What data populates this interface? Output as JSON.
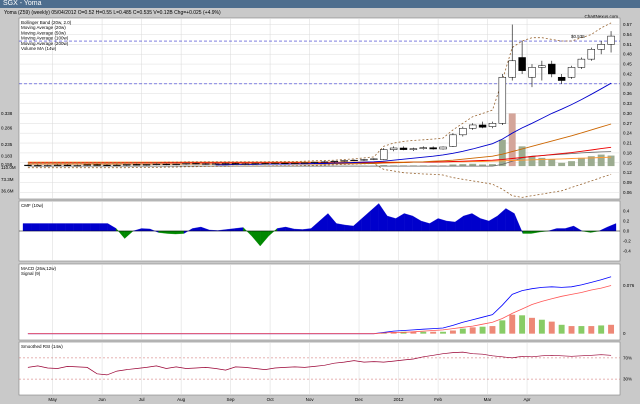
{
  "window": {
    "title": "SGX - Yoma"
  },
  "header": {
    "line": "Yoma (Z59) (weekly)     05/04/2012     O=0.52     H=0.55     L=0.485     C=0.535     V=0.12B     Chg=+0.025 (+4.9%)"
  },
  "watermark": "ChartNexus.com",
  "price_legend": [
    "Bollinger Band (20w, 2.0)",
    "Moving Average (20w)",
    "Moving Average (50w)",
    "Moving Average (100w)",
    "Moving Average (200w)",
    "Volume MA (14w)"
  ],
  "colors": {
    "bg": "#c9c9c9",
    "panel": "#ffffff",
    "bollinger": "#996633",
    "ma20": "#0000cc",
    "ma50": "#cc6600",
    "ma100": "#ee0000",
    "ma200": "#ff9933",
    "volume": "#9cac90",
    "cmf": "#0000cc",
    "cmf_neg": "#008800",
    "macd": "#0000ff",
    "signal": "#ff5555",
    "rsi": "#990033"
  },
  "chart_data": [
    {
      "type": "candlestick",
      "title": "Yoma (Z59) (weekly)",
      "right_ticks": [
        0.57,
        0.54,
        0.51,
        0.48,
        0.45,
        0.42,
        0.39,
        0.36,
        0.33,
        0.3,
        0.27,
        0.24,
        0.21,
        0.18,
        0.15,
        0.12,
        0.09,
        0.06
      ],
      "left_ticks": [
        {
          "label": "0.338",
          "v": 0.3
        },
        {
          "label": "0.286",
          "v": 0.255
        },
        {
          "label": "0.235",
          "v": 0.205
        },
        {
          "label": "0.183",
          "v": 0.17
        },
        {
          "label": "0.158",
          "v": 0.145
        },
        {
          "label": "110.0M",
          "v": 0.135
        },
        {
          "label": "73.3M",
          "v": 0.1
        },
        {
          "label": "36.6M",
          "v": 0.065
        }
      ],
      "ylim": [
        0.04,
        0.59
      ],
      "annotation": "$0.535",
      "hlines": [
        0.52,
        0.39
      ],
      "x_labels": [
        "May",
        "Jun",
        "Jul",
        "Aug",
        "Sep",
        "Oct",
        "Nov",
        "Dec",
        "2012",
        "Feb",
        "Mar",
        "Apr"
      ],
      "candles": [
        {
          "o": 0.143,
          "h": 0.145,
          "l": 0.14,
          "c": 0.142
        },
        {
          "o": 0.142,
          "h": 0.145,
          "l": 0.14,
          "c": 0.141
        },
        {
          "o": 0.141,
          "h": 0.144,
          "l": 0.139,
          "c": 0.142
        },
        {
          "o": 0.142,
          "h": 0.145,
          "l": 0.14,
          "c": 0.143
        },
        {
          "o": 0.143,
          "h": 0.145,
          "l": 0.14,
          "c": 0.141
        },
        {
          "o": 0.141,
          "h": 0.144,
          "l": 0.139,
          "c": 0.142
        },
        {
          "o": 0.142,
          "h": 0.145,
          "l": 0.141,
          "c": 0.144
        },
        {
          "o": 0.144,
          "h": 0.146,
          "l": 0.141,
          "c": 0.143
        },
        {
          "o": 0.143,
          "h": 0.145,
          "l": 0.14,
          "c": 0.142
        },
        {
          "o": 0.142,
          "h": 0.145,
          "l": 0.14,
          "c": 0.143
        },
        {
          "o": 0.143,
          "h": 0.146,
          "l": 0.141,
          "c": 0.145
        },
        {
          "o": 0.145,
          "h": 0.147,
          "l": 0.143,
          "c": 0.144
        },
        {
          "o": 0.144,
          "h": 0.146,
          "l": 0.142,
          "c": 0.145
        },
        {
          "o": 0.145,
          "h": 0.148,
          "l": 0.143,
          "c": 0.146
        },
        {
          "o": 0.146,
          "h": 0.148,
          "l": 0.143,
          "c": 0.145
        },
        {
          "o": 0.145,
          "h": 0.147,
          "l": 0.143,
          "c": 0.146
        },
        {
          "o": 0.146,
          "h": 0.15,
          "l": 0.144,
          "c": 0.148
        },
        {
          "o": 0.148,
          "h": 0.15,
          "l": 0.145,
          "c": 0.147
        },
        {
          "o": 0.147,
          "h": 0.149,
          "l": 0.144,
          "c": 0.146
        },
        {
          "o": 0.146,
          "h": 0.149,
          "l": 0.144,
          "c": 0.147
        },
        {
          "o": 0.147,
          "h": 0.15,
          "l": 0.145,
          "c": 0.148
        },
        {
          "o": 0.148,
          "h": 0.15,
          "l": 0.145,
          "c": 0.146
        },
        {
          "o": 0.146,
          "h": 0.149,
          "l": 0.144,
          "c": 0.147
        },
        {
          "o": 0.147,
          "h": 0.149,
          "l": 0.145,
          "c": 0.148
        },
        {
          "o": 0.148,
          "h": 0.15,
          "l": 0.145,
          "c": 0.147
        },
        {
          "o": 0.147,
          "h": 0.15,
          "l": 0.145,
          "c": 0.149
        },
        {
          "o": 0.149,
          "h": 0.151,
          "l": 0.146,
          "c": 0.148
        },
        {
          "o": 0.148,
          "h": 0.15,
          "l": 0.146,
          "c": 0.149
        },
        {
          "o": 0.149,
          "h": 0.151,
          "l": 0.147,
          "c": 0.15
        },
        {
          "o": 0.15,
          "h": 0.153,
          "l": 0.148,
          "c": 0.152
        },
        {
          "o": 0.152,
          "h": 0.155,
          "l": 0.15,
          "c": 0.153
        },
        {
          "o": 0.153,
          "h": 0.156,
          "l": 0.151,
          "c": 0.155
        },
        {
          "o": 0.155,
          "h": 0.158,
          "l": 0.153,
          "c": 0.157
        },
        {
          "o": 0.157,
          "h": 0.16,
          "l": 0.155,
          "c": 0.158
        },
        {
          "o": 0.158,
          "h": 0.162,
          "l": 0.156,
          "c": 0.16
        },
        {
          "o": 0.16,
          "h": 0.164,
          "l": 0.158,
          "c": 0.162
        },
        {
          "o": 0.16,
          "h": 0.195,
          "l": 0.158,
          "c": 0.19
        },
        {
          "o": 0.19,
          "h": 0.2,
          "l": 0.185,
          "c": 0.195
        },
        {
          "o": 0.195,
          "h": 0.2,
          "l": 0.188,
          "c": 0.19
        },
        {
          "o": 0.19,
          "h": 0.196,
          "l": 0.186,
          "c": 0.193
        },
        {
          "o": 0.193,
          "h": 0.2,
          "l": 0.19,
          "c": 0.196
        },
        {
          "o": 0.196,
          "h": 0.2,
          "l": 0.19,
          "c": 0.192
        },
        {
          "o": 0.192,
          "h": 0.2,
          "l": 0.19,
          "c": 0.198
        },
        {
          "o": 0.2,
          "h": 0.24,
          "l": 0.198,
          "c": 0.235
        },
        {
          "o": 0.235,
          "h": 0.26,
          "l": 0.23,
          "c": 0.255
        },
        {
          "o": 0.255,
          "h": 0.27,
          "l": 0.25,
          "c": 0.265
        },
        {
          "o": 0.265,
          "h": 0.275,
          "l": 0.255,
          "c": 0.258
        },
        {
          "o": 0.26,
          "h": 0.275,
          "l": 0.255,
          "c": 0.27
        },
        {
          "o": 0.27,
          "h": 0.42,
          "l": 0.265,
          "c": 0.41
        },
        {
          "o": 0.41,
          "h": 0.57,
          "l": 0.4,
          "c": 0.46
        },
        {
          "o": 0.47,
          "h": 0.52,
          "l": 0.42,
          "c": 0.43
        },
        {
          "o": 0.41,
          "h": 0.45,
          "l": 0.38,
          "c": 0.44
        },
        {
          "o": 0.44,
          "h": 0.46,
          "l": 0.4,
          "c": 0.445
        },
        {
          "o": 0.45,
          "h": 0.46,
          "l": 0.41,
          "c": 0.42
        },
        {
          "o": 0.41,
          "h": 0.42,
          "l": 0.39,
          "c": 0.4
        },
        {
          "o": 0.41,
          "h": 0.445,
          "l": 0.405,
          "c": 0.44
        },
        {
          "o": 0.44,
          "h": 0.47,
          "l": 0.435,
          "c": 0.465
        },
        {
          "o": 0.465,
          "h": 0.5,
          "l": 0.46,
          "c": 0.495
        },
        {
          "o": 0.495,
          "h": 0.52,
          "l": 0.48,
          "c": 0.51
        },
        {
          "o": 0.51,
          "h": 0.55,
          "l": 0.485,
          "c": 0.535
        }
      ],
      "bollinger_upper": [
        0.15,
        0.15,
        0.15,
        0.15,
        0.15,
        0.15,
        0.15,
        0.15,
        0.15,
        0.15,
        0.15,
        0.151,
        0.151,
        0.151,
        0.152,
        0.152,
        0.153,
        0.153,
        0.153,
        0.153,
        0.153,
        0.153,
        0.153,
        0.153,
        0.153,
        0.154,
        0.154,
        0.154,
        0.155,
        0.156,
        0.157,
        0.158,
        0.16,
        0.162,
        0.165,
        0.168,
        0.2,
        0.21,
        0.215,
        0.218,
        0.22,
        0.222,
        0.225,
        0.25,
        0.27,
        0.29,
        0.3,
        0.31,
        0.4,
        0.5,
        0.52,
        0.53,
        0.53,
        0.525,
        0.52,
        0.52,
        0.53,
        0.54,
        0.56,
        0.575
      ],
      "bollinger_lower": [
        0.135,
        0.135,
        0.135,
        0.135,
        0.135,
        0.135,
        0.135,
        0.135,
        0.135,
        0.135,
        0.135,
        0.136,
        0.136,
        0.136,
        0.137,
        0.137,
        0.138,
        0.138,
        0.139,
        0.139,
        0.139,
        0.14,
        0.14,
        0.14,
        0.14,
        0.141,
        0.141,
        0.141,
        0.142,
        0.142,
        0.143,
        0.144,
        0.145,
        0.146,
        0.147,
        0.148,
        0.13,
        0.125,
        0.12,
        0.118,
        0.116,
        0.115,
        0.113,
        0.105,
        0.1,
        0.095,
        0.09,
        0.085,
        0.07,
        0.05,
        0.045,
        0.05,
        0.055,
        0.06,
        0.065,
        0.075,
        0.085,
        0.095,
        0.105,
        0.115
      ],
      "ma20": [
        null,
        null,
        null,
        null,
        null,
        null,
        null,
        null,
        null,
        null,
        null,
        null,
        null,
        null,
        null,
        null,
        null,
        null,
        null,
        0.144,
        0.144,
        0.145,
        0.145,
        0.145,
        0.146,
        0.146,
        0.146,
        0.147,
        0.147,
        0.148,
        0.148,
        0.149,
        0.15,
        0.151,
        0.152,
        0.153,
        0.155,
        0.158,
        0.161,
        0.164,
        0.167,
        0.17,
        0.174,
        0.179,
        0.185,
        0.192,
        0.2,
        0.208,
        0.222,
        0.24,
        0.256,
        0.27,
        0.285,
        0.3,
        0.313,
        0.327,
        0.342,
        0.358,
        0.375,
        0.392
      ],
      "ma50": [
        0.146,
        0.146,
        0.146,
        0.146,
        0.146,
        0.146,
        0.146,
        0.146,
        0.146,
        0.146,
        0.146,
        0.146,
        0.146,
        0.146,
        0.146,
        0.146,
        0.146,
        0.146,
        0.146,
        0.146,
        0.146,
        0.146,
        0.146,
        0.146,
        0.146,
        0.146,
        0.146,
        0.146,
        0.146,
        0.146,
        0.146,
        0.147,
        0.147,
        0.147,
        0.148,
        0.148,
        0.149,
        0.15,
        0.151,
        0.152,
        0.153,
        0.155,
        0.156,
        0.158,
        0.161,
        0.164,
        0.167,
        0.17,
        0.176,
        0.184,
        0.192,
        0.2,
        0.208,
        0.216,
        0.224,
        0.232,
        0.241,
        0.25,
        0.259,
        0.268
      ],
      "ma100": [
        0.15,
        0.15,
        0.15,
        0.15,
        0.15,
        0.15,
        0.15,
        0.15,
        0.15,
        0.15,
        0.15,
        0.15,
        0.15,
        0.15,
        0.15,
        0.15,
        0.15,
        0.15,
        0.15,
        0.15,
        0.15,
        0.15,
        0.15,
        0.15,
        0.15,
        0.15,
        0.15,
        0.15,
        0.15,
        0.15,
        0.15,
        0.15,
        0.15,
        0.15,
        0.15,
        0.15,
        0.151,
        0.151,
        0.151,
        0.152,
        0.152,
        0.152,
        0.153,
        0.154,
        0.155,
        0.156,
        0.157,
        0.158,
        0.16,
        0.163,
        0.166,
        0.169,
        0.172,
        0.175,
        0.178,
        0.181,
        0.185,
        0.189,
        0.193,
        0.197
      ],
      "ma200": [
        0.152,
        0.152,
        0.152,
        0.152,
        0.152,
        0.152,
        0.152,
        0.152,
        0.152,
        0.152,
        0.152,
        0.152,
        0.152,
        0.152,
        0.152,
        0.152,
        0.152,
        0.152,
        0.152,
        0.152,
        0.152,
        0.152,
        0.152,
        0.152,
        0.152,
        0.152,
        0.152,
        0.152,
        0.152,
        0.152,
        0.152,
        0.152,
        0.152,
        0.152,
        0.152,
        0.152,
        0.152,
        0.152,
        0.152,
        0.152,
        0.152,
        0.152,
        0.152,
        0.153,
        0.153,
        0.154,
        0.154,
        0.155,
        0.156,
        0.157,
        0.158,
        0.159,
        0.16,
        0.161,
        0.162,
        0.163,
        0.164,
        0.165,
        0.166,
        0.167
      ],
      "volume": [
        0.141,
        0.141,
        0.141,
        0.141,
        0.141,
        0.141,
        0.141,
        0.141,
        0.141,
        0.141,
        0.141,
        0.141,
        0.141,
        0.141,
        0.141,
        0.141,
        0.141,
        0.141,
        0.141,
        0.141,
        0.141,
        0.141,
        0.141,
        0.141,
        0.141,
        0.141,
        0.141,
        0.141,
        0.141,
        0.141,
        0.141,
        0.141,
        0.141,
        0.141,
        0.141,
        0.141,
        0.143,
        0.142,
        0.142,
        0.142,
        0.142,
        0.142,
        0.142,
        0.145,
        0.146,
        0.147,
        0.145,
        0.146,
        0.22,
        0.3,
        0.2,
        0.17,
        0.165,
        0.16,
        0.15,
        0.155,
        0.165,
        0.17,
        0.175,
        0.172
      ],
      "volume_ma": [
        0.14,
        0.14,
        0.14,
        0.14,
        0.14,
        0.14,
        0.14,
        0.14,
        0.14,
        0.14,
        0.14,
        0.14,
        0.14,
        0.14,
        0.14,
        0.14,
        0.14,
        0.14,
        0.14,
        0.14,
        0.14,
        0.14,
        0.14,
        0.14,
        0.14,
        0.14,
        0.14,
        0.14,
        0.14,
        0.14,
        0.14,
        0.14,
        0.14,
        0.14,
        0.14,
        0.14,
        0.14,
        0.14,
        0.14,
        0.14,
        0.14,
        0.14,
        0.14,
        0.14,
        0.14,
        0.14,
        0.14,
        0.14,
        0.145,
        0.155,
        0.165,
        0.17,
        0.172,
        0.174,
        0.176,
        0.178,
        0.18,
        0.182,
        0.183,
        0.184
      ]
    },
    {
      "type": "area",
      "title": "CMF (10w)",
      "ylim": [
        -0.6,
        0.6
      ],
      "ticks": [
        0.4,
        0.2,
        0.0,
        -0.2,
        -0.4
      ],
      "values": [
        0.15,
        0.15,
        0.15,
        0.15,
        0.15,
        0.15,
        0.15,
        0.15,
        0.15,
        0.15,
        0.15,
        0.05,
        -0.15,
        0.0,
        0.05,
        0.04,
        -0.03,
        -0.05,
        -0.06,
        -0.05,
        0.05,
        0.08,
        0.02,
        0.01,
        0.03,
        0.05,
        0.07,
        -0.1,
        -0.3,
        -0.1,
        0.05,
        0.08,
        0.04,
        0.03,
        0.05,
        0.2,
        0.35,
        0.15,
        0.12,
        0.1,
        0.25,
        0.4,
        0.55,
        0.3,
        0.25,
        0.35,
        0.3,
        0.2,
        0.15,
        0.25,
        0.2,
        0.18,
        0.3,
        0.35,
        0.25,
        0.2,
        0.3,
        0.45,
        0.35,
        -0.05,
        -0.05,
        -0.02,
        0.0,
        0.05,
        0.05,
        0.1,
        0.0,
        -0.03,
        0.0,
        0.08,
        0.15
      ]
    },
    {
      "type": "line",
      "title": "MACD (26w,12w)",
      "legend": [
        "Signal (9)"
      ],
      "ylim": [
        -0.01,
        0.11
      ],
      "ticks": [
        {
          "label": "0.076",
          "v": 0.076
        },
        {
          "label": "0",
          "v": 0.0
        }
      ],
      "macd": [
        0,
        0,
        0,
        0,
        0,
        0,
        0,
        0,
        0,
        0,
        0,
        0,
        0,
        0,
        0,
        0,
        0,
        0,
        0,
        0,
        0,
        0,
        0,
        0,
        0,
        0,
        0,
        0,
        0,
        0,
        0,
        0,
        0,
        0,
        0,
        0,
        0.002,
        0.004,
        0.005,
        0.006,
        0.007,
        0.008,
        0.009,
        0.013,
        0.018,
        0.022,
        0.026,
        0.03,
        0.045,
        0.062,
        0.068,
        0.071,
        0.073,
        0.074,
        0.073,
        0.074,
        0.077,
        0.081,
        0.085,
        0.09
      ],
      "signal": [
        0,
        0,
        0,
        0,
        0,
        0,
        0,
        0,
        0,
        0,
        0,
        0,
        0,
        0,
        0,
        0,
        0,
        0,
        0,
        0,
        0,
        0,
        0,
        0,
        0,
        0,
        0,
        0,
        0,
        0,
        0,
        0,
        0,
        0,
        0,
        0,
        0.001,
        0.002,
        0.002,
        0.003,
        0.004,
        0.005,
        0.006,
        0.008,
        0.01,
        0.012,
        0.015,
        0.018,
        0.024,
        0.032,
        0.039,
        0.046,
        0.051,
        0.055,
        0.059,
        0.062,
        0.065,
        0.069,
        0.072,
        0.076
      ]
    },
    {
      "type": "line",
      "title": "Smoothed RSI (14w)",
      "ylim": [
        0,
        100
      ],
      "ticks": [
        {
          "label": "70%",
          "v": 70
        },
        {
          "label": "30%",
          "v": 30
        }
      ],
      "values": [
        52,
        55,
        51,
        50,
        54,
        53,
        52,
        40,
        38,
        45,
        48,
        50,
        52,
        55,
        50,
        53,
        50,
        51,
        52,
        50,
        47,
        53,
        52,
        50,
        48,
        51,
        52,
        53,
        52,
        54,
        56,
        60,
        62,
        65,
        62,
        63,
        62,
        64,
        66,
        68,
        72,
        75,
        78,
        80,
        81,
        78,
        77,
        74,
        72,
        70,
        73,
        72,
        74,
        75,
        74,
        73,
        74,
        75,
        76,
        75
      ]
    }
  ]
}
